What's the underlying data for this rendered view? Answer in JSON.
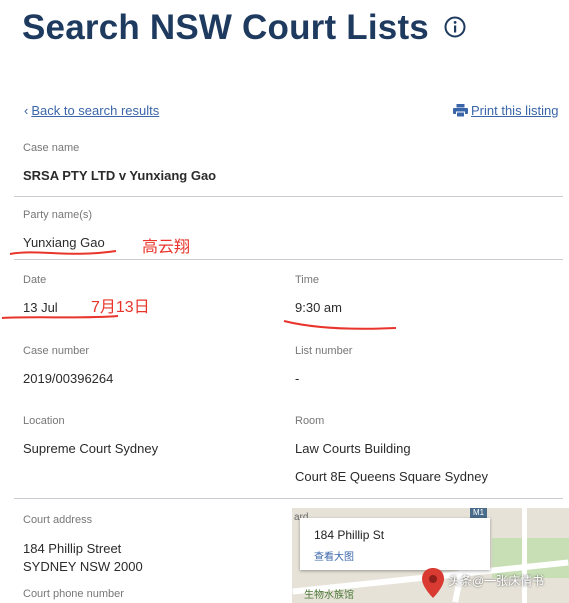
{
  "header": {
    "title": "Search NSW Court Lists",
    "info_icon": "info-circle-icon"
  },
  "nav": {
    "back_label": "Back to search results",
    "print_label": "Print this listing"
  },
  "case": {
    "case_name_label": "Case name",
    "case_name": "SRSA PTY LTD v Yunxiang Gao",
    "party_label": "Party name(s)",
    "party": "Yunxiang Gao",
    "date_label": "Date",
    "date": "13 Jul",
    "time_label": "Time",
    "time": "9:30 am",
    "case_number_label": "Case number",
    "case_number": "2019/00396264",
    "list_number_label": "List number",
    "list_number": "-",
    "location_label": "Location",
    "location": "Supreme Court Sydney",
    "room_label": "Room",
    "room_line1": "Law Courts Building",
    "room_line2": "Court 8E Queens Square Sydney",
    "court_address_label": "Court address",
    "court_address_line1": "184 Phillip Street",
    "court_address_line2": "SYDNEY NSW 2000",
    "court_phone_label": "Court phone number"
  },
  "annotations": {
    "party_note": "高云翔",
    "date_note": "7月13日",
    "color": "#e8342a"
  },
  "map": {
    "popup_address": "184 Phillip St",
    "popup_link": "查看大图",
    "poi_label": "生物水族馆",
    "road_badge": "M1",
    "fragment": "ard"
  },
  "watermark": "头条@一张床情书",
  "colors": {
    "title": "#1e3a5f",
    "link": "#3a66a9",
    "pin": "#d93a32"
  }
}
